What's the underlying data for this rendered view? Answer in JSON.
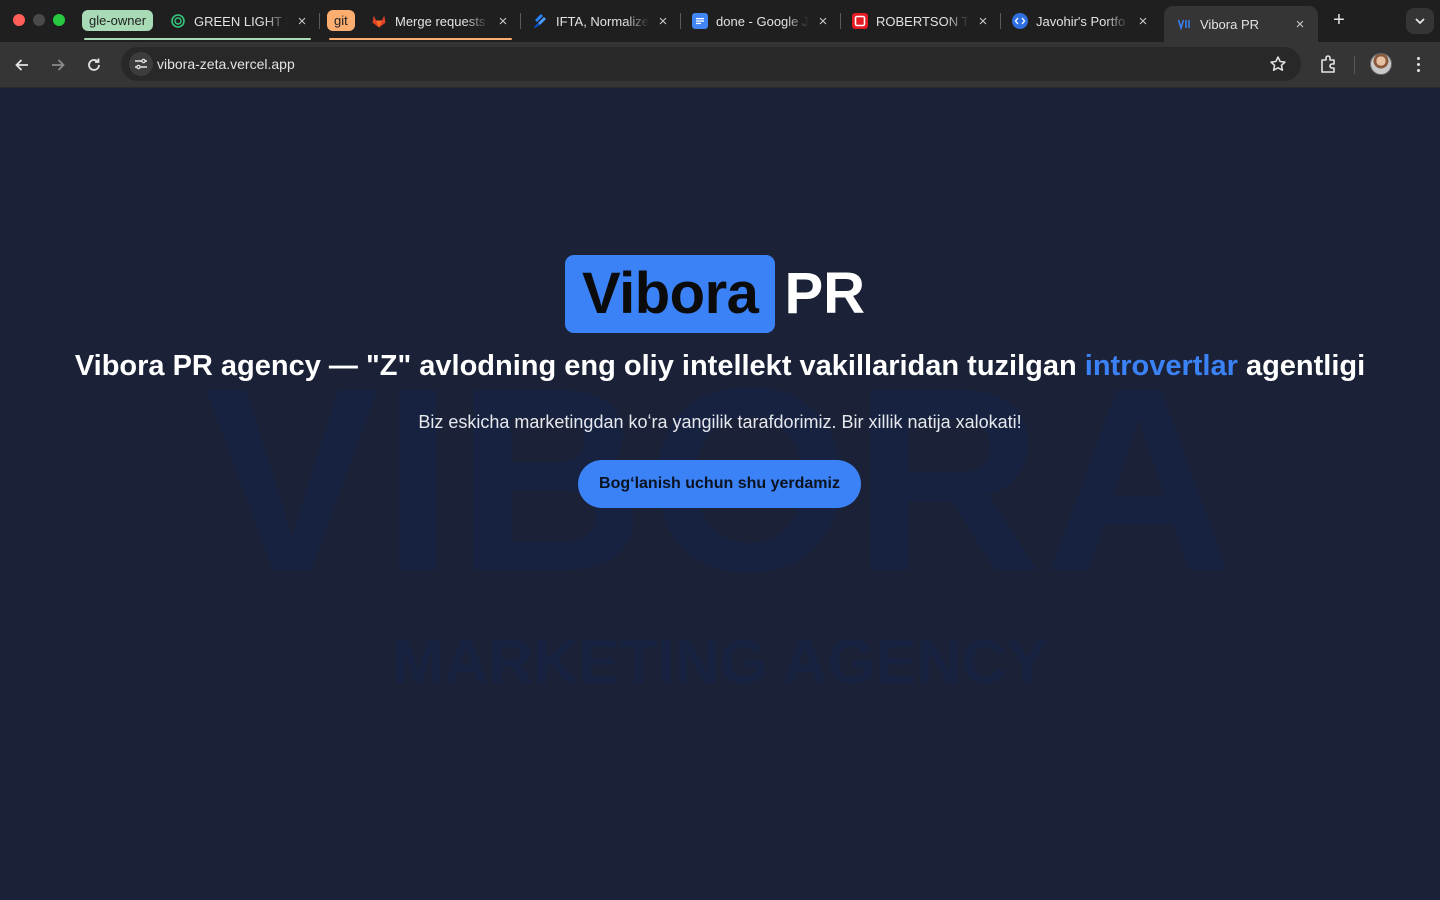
{
  "browser": {
    "tab_groups": [
      {
        "label": "gle-owner",
        "color": "#a8dab5"
      },
      {
        "label": "git",
        "color": "#fcad70"
      }
    ],
    "tabs": [
      {
        "title": "GREEN LIGHT E",
        "icon": "green-light-icon"
      },
      {
        "title": "Merge requests",
        "icon": "gitlab-icon"
      },
      {
        "title": "IFTA, Normalize",
        "icon": "jira-icon"
      },
      {
        "title": "done - Google J",
        "icon": "google-docs-icon"
      },
      {
        "title": "ROBERTSON TI",
        "icon": "robertson-icon"
      },
      {
        "title": "Javohir's Portfo",
        "icon": "code-icon"
      },
      {
        "title": "Vibora PR",
        "icon": "vibora-icon",
        "active": true
      }
    ],
    "close_glyph": "×",
    "new_tab_glyph": "+",
    "address": "vibora-zeta.vercel.app"
  },
  "page": {
    "logo": {
      "boxed": "Vibora",
      "suffix": "PR"
    },
    "headline": {
      "before": "Vibora PR agency — \"Z\" avlodning eng oliy intellekt vakillaridan tuzilgan ",
      "accent": "introvertlar",
      "after": " agentligi"
    },
    "tagline": "Biz eskicha marketingdan koʻra yangilik tarafdorimiz. Bir xillik natija xalokati!",
    "cta_label": "Bogʻlanish uchun shu yerdamiz",
    "background_word": "VIBORA",
    "background_subtitle": "MARKETING AGENCY"
  },
  "colors": {
    "accent": "#3b82f6",
    "page_background": "#1b2237",
    "watermark": "#16223f"
  }
}
